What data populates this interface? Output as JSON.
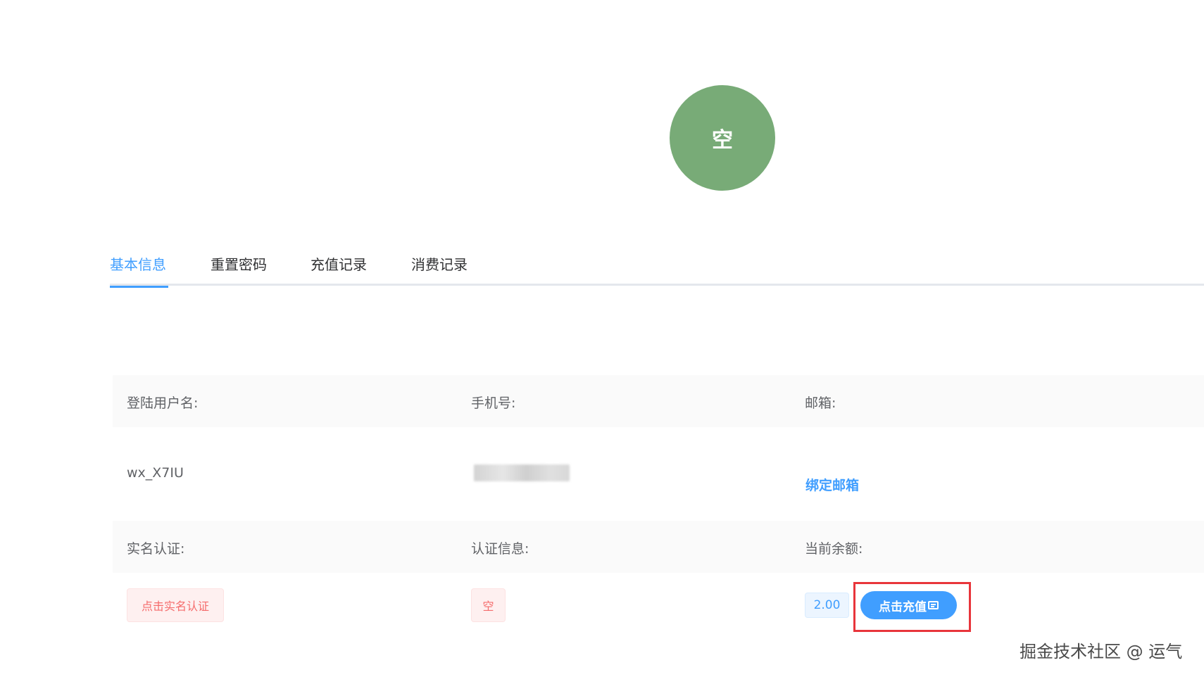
{
  "avatar": {
    "text": "空",
    "color": "#78ab77"
  },
  "tabs": [
    {
      "label": "基本信息",
      "active": true
    },
    {
      "label": "重置密码",
      "active": false
    },
    {
      "label": "充值记录",
      "active": false
    },
    {
      "label": "消费记录",
      "active": false
    }
  ],
  "info": {
    "username_label": "登陆用户名:",
    "phone_label": "手机号:",
    "email_label": "邮箱:",
    "username_value": "wx_X7IU",
    "bind_email_link": "绑定邮箱",
    "realname_label": "实名认证:",
    "cert_info_label": "认证信息:",
    "balance_label": "当前余额:",
    "realname_button": "点击实名认证",
    "cert_info_value": "空",
    "balance_value": "2.00",
    "recharge_button": "点击充值",
    "recharge_icon": "wallet-icon"
  },
  "colors": {
    "primary": "#409eff",
    "danger": "#f56c6c",
    "highlight": "#e8353b"
  },
  "watermark": "掘金技术社区 @ 运气"
}
